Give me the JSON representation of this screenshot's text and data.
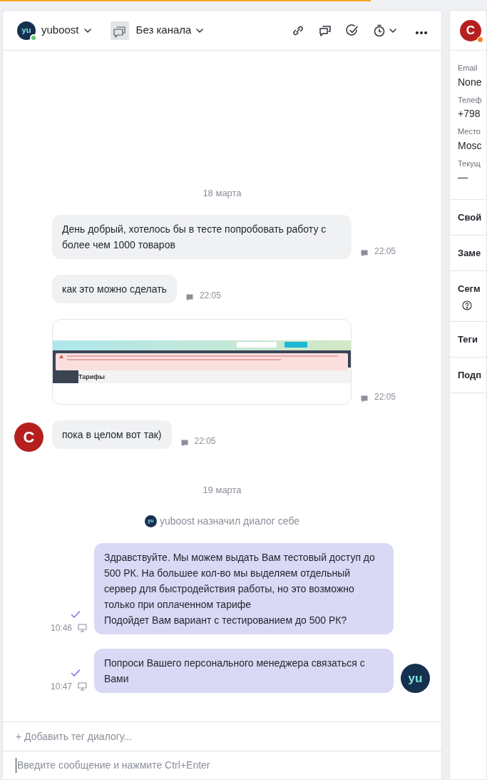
{
  "header": {
    "agent": {
      "name": "yuboost",
      "logo": "yu",
      "online": true
    },
    "channel": {
      "label": "Без канала"
    }
  },
  "messages": [
    {
      "kind": "date",
      "text": "18 марта"
    },
    {
      "kind": "incoming",
      "text": "День добрый, хотелось бы в тесте попробовать работу с более чем 1000 товаров",
      "time": "22:05"
    },
    {
      "kind": "incoming",
      "text": "как это можно сделать",
      "time": "22:05"
    },
    {
      "kind": "attachment",
      "caption": "Тарифы",
      "time": "22:05"
    },
    {
      "kind": "incoming",
      "text": "пока в целом вот так)",
      "time": "22:05",
      "avatar": "C"
    },
    {
      "kind": "date",
      "text": "19 марта"
    },
    {
      "kind": "system",
      "logo": "yu",
      "text": "yuboost назначил диалог себе"
    },
    {
      "kind": "outgoing",
      "text": "Здравствуйте. Мы можем выдать Вам тестовый доступ до 500 РК. На большее кол-во мы выделяем отдельный сервер для быстродействия работы, но это возможно только при оплаченном тарифе\nПодойдет Вам вариант с тестированием до 500 РК?",
      "time": "10:46",
      "delivered": true
    },
    {
      "kind": "outgoing",
      "text": "Попроси Вашего персонального менеджера связаться с Вами",
      "time": "10:47",
      "delivered": true,
      "avatar": "yu"
    }
  ],
  "tag_link": "+ Добавить тег диалогу...",
  "composer": {
    "placeholder": "Введите сообщение и нажмите Ctrl+Enter"
  },
  "contact": {
    "avatar": "C",
    "away": true,
    "fields": [
      {
        "label": "Email",
        "value": "None"
      },
      {
        "label": "Телеф",
        "value": "+798"
      },
      {
        "label": "Место",
        "value": "Mosc"
      },
      {
        "label": "Текущ",
        "value": "—"
      }
    ],
    "sections": [
      {
        "title": "Свой",
        "help": false
      },
      {
        "title": "Заме",
        "help": false
      },
      {
        "title": "Сегм",
        "help": true
      },
      {
        "title": "Теги",
        "help": false
      },
      {
        "title": "Подп",
        "help": false
      }
    ]
  }
}
